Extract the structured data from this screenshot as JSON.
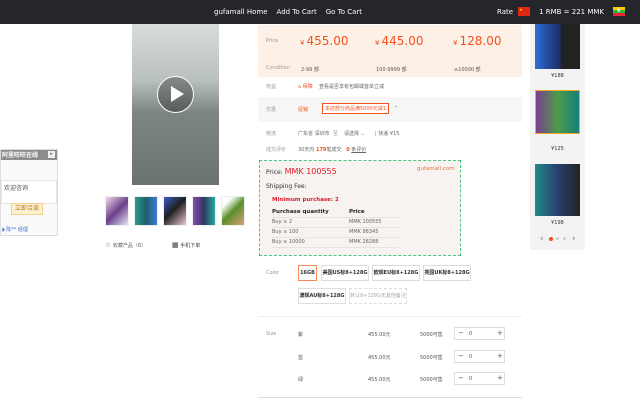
{
  "topbar": {
    "nav": [
      "gufamall Home",
      "Add To Cart",
      "Go To Cart"
    ],
    "rate_label": "Rate",
    "rate_value": "1 RMB = 221 MMK"
  },
  "chat": {
    "title": "阿里旺旺在线",
    "bubble": "欢迎咨询",
    "button": "立即洽谈",
    "manager": "陈** 经理"
  },
  "gallery": {
    "collect": "收藏产品（8）",
    "mobile_order": "手机下单"
  },
  "price_table": {
    "price_label": "Price",
    "condition_label": "Condition",
    "currency": "¥",
    "tiers": [
      {
        "price": "455.00",
        "condition": "2-99 部"
      },
      {
        "price": "445.00",
        "condition": "100-9999 部"
      },
      {
        "price": "128.00",
        "condition": "≥10000 部"
      }
    ]
  },
  "benefits": {
    "label": "权益",
    "tag": "保障",
    "text": "查看是否享有包邮或首单立减"
  },
  "coupon": {
    "label": "优惠",
    "tag": "促销",
    "text": "本店部分商品满5000元减1...",
    "chevron": "⌄"
  },
  "logistics": {
    "label": "物流",
    "from": "广东省 深圳市",
    "to_label": "至",
    "select": "请选择",
    "express": "快递 ¥15"
  },
  "reviews": {
    "label": "成交评价",
    "prefix": "30天内",
    "count": "179",
    "mid": "笔成交",
    "zero": "0",
    "suffix": "条评价"
  },
  "mmk": {
    "price_label": "Price:",
    "price_value": "MMK 100555",
    "brand": "gufamall.com",
    "shipping": "Shipping Fee:",
    "minimum": "Minimum purchase: 2",
    "headers": [
      "Purchase quantity",
      "Price"
    ],
    "rows": [
      [
        "Buy ≥ 2",
        "MMK 100555"
      ],
      [
        "Buy ≥ 100",
        "MMK 98345"
      ],
      [
        "Buy ≥ 10000",
        "MMK 28288"
      ]
    ]
  },
  "color": {
    "label": "Color",
    "options": [
      "16GB",
      "美国US标8+128G",
      "欧规EU标8+128G",
      "英国UK标8+128G",
      "澳规AU标8+128G",
      "默认8+128G无其他备注"
    ],
    "selected": "16GB"
  },
  "size": {
    "label": "Size",
    "rows": [
      {
        "name": "紫",
        "price": "455.00元",
        "stock": "5000可售",
        "qty": "0"
      },
      {
        "name": "蓝",
        "price": "455.00元",
        "stock": "5000可售",
        "qty": "0"
      },
      {
        "name": "绿",
        "price": "455.00元",
        "stock": "5000可售",
        "qty": "0"
      }
    ]
  },
  "sidebar": {
    "prices": [
      "¥188",
      "¥125",
      "¥198"
    ],
    "prev": "‹",
    "next": "›"
  },
  "colors": {
    "accent": "#f4511e",
    "topbar": "#24262b",
    "price_bg": "#fdf1e7",
    "dashed_border": "#4cc583"
  }
}
